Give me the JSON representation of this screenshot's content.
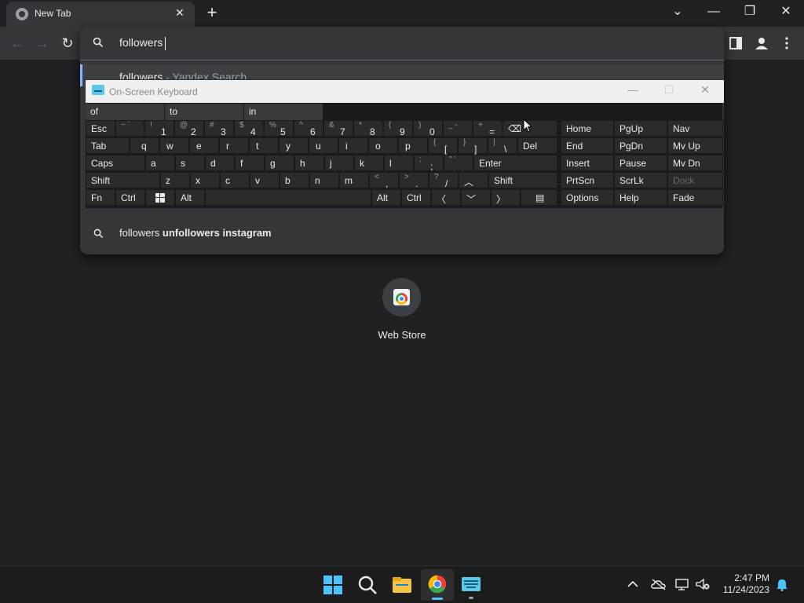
{
  "browser": {
    "tab_title": "New Tab",
    "tab_close": "✕",
    "new_tab": "+",
    "win_controls": {
      "tabsearch": "⌄",
      "minimize": "—",
      "restore": "❐",
      "close": "✕"
    },
    "nav": {
      "back": "←",
      "forward": "→",
      "reload": "↻"
    }
  },
  "omnibox": {
    "input_value": "followers",
    "suggestions": [
      {
        "prefix": "followers",
        "suffix": " - Yandex Search"
      },
      {
        "prefix": "followers ",
        "bold": "unfollowers instagram"
      }
    ]
  },
  "osk": {
    "title": "On-Screen Keyboard",
    "predictions": [
      "of",
      "to",
      "in"
    ],
    "row1": [
      "Esc"
    ],
    "row2": [
      "Tab",
      "q",
      "w",
      "e",
      "r",
      "t",
      "y",
      "u",
      "i",
      "o",
      "p",
      "Del"
    ],
    "row3": [
      "Caps",
      "a",
      "s",
      "d",
      "f",
      "g",
      "h",
      "j",
      "k",
      "l",
      "Enter"
    ],
    "row4": [
      "Shift",
      "z",
      "x",
      "c",
      "v",
      "b",
      "n",
      "m",
      "Shift"
    ],
    "row5": [
      "Fn",
      "Ctrl",
      "Alt",
      "Alt",
      "Ctrl"
    ],
    "nav_keys": [
      "Home",
      "PgUp",
      "Nav",
      "End",
      "PgDn",
      "Mv Up",
      "Insert",
      "Pause",
      "Mv Dn",
      "PrtScn",
      "ScrLk",
      "Dock",
      "Options",
      "Help",
      "Fade"
    ]
  },
  "shortcut": {
    "label": "Web Store"
  },
  "taskbar": {
    "time": "2:47 PM",
    "date": "11/24/2023"
  }
}
